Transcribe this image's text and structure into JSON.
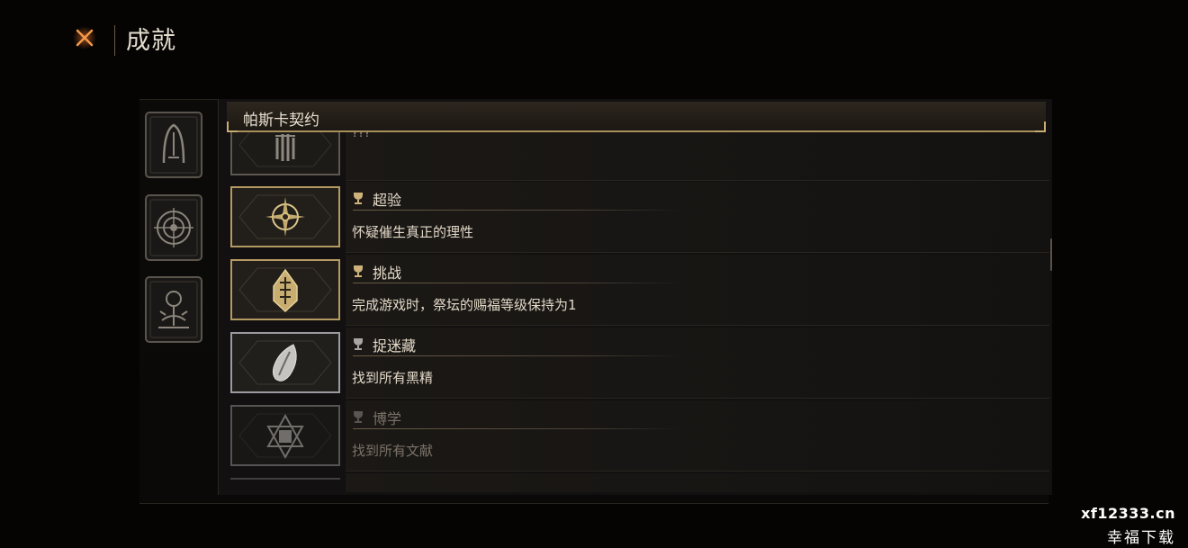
{
  "header": {
    "title": "成就",
    "close_icon": "close-x-icon"
  },
  "categories": [
    {
      "icon": "altar-arch-icon",
      "selected": false
    },
    {
      "icon": "spiral-eye-icon",
      "selected": false
    },
    {
      "icon": "sprouting-seed-icon",
      "selected": false
    }
  ],
  "section": {
    "title": "帕斯卡契约"
  },
  "achievements": [
    {
      "name": "",
      "desc": "???",
      "icon": "crown-sigil-icon",
      "state": "unknown",
      "unlocked": false
    },
    {
      "name": "超验",
      "desc": "怀疑催生真正的理性",
      "icon": "compass-star-icon",
      "state": "unlocked",
      "unlocked": true
    },
    {
      "name": "挑战",
      "desc": "完成游戏时，祭坛的赐福等级保持为1",
      "icon": "rune-crystal-icon",
      "state": "unlocked",
      "unlocked": true
    },
    {
      "name": "捉迷藏",
      "desc": "找到所有黑精",
      "icon": "silver-seed-icon",
      "state": "locked",
      "unlocked": false
    },
    {
      "name": "博学",
      "desc": "找到所有文献",
      "icon": "hexagram-tome-icon",
      "state": "dim",
      "unlocked": false
    }
  ],
  "colors": {
    "gold": "#c9ad72",
    "silver": "#9a9aa0",
    "text": "#e2d8c8"
  },
  "watermark": {
    "url": "xf12333.cn",
    "name": "幸福下载"
  }
}
